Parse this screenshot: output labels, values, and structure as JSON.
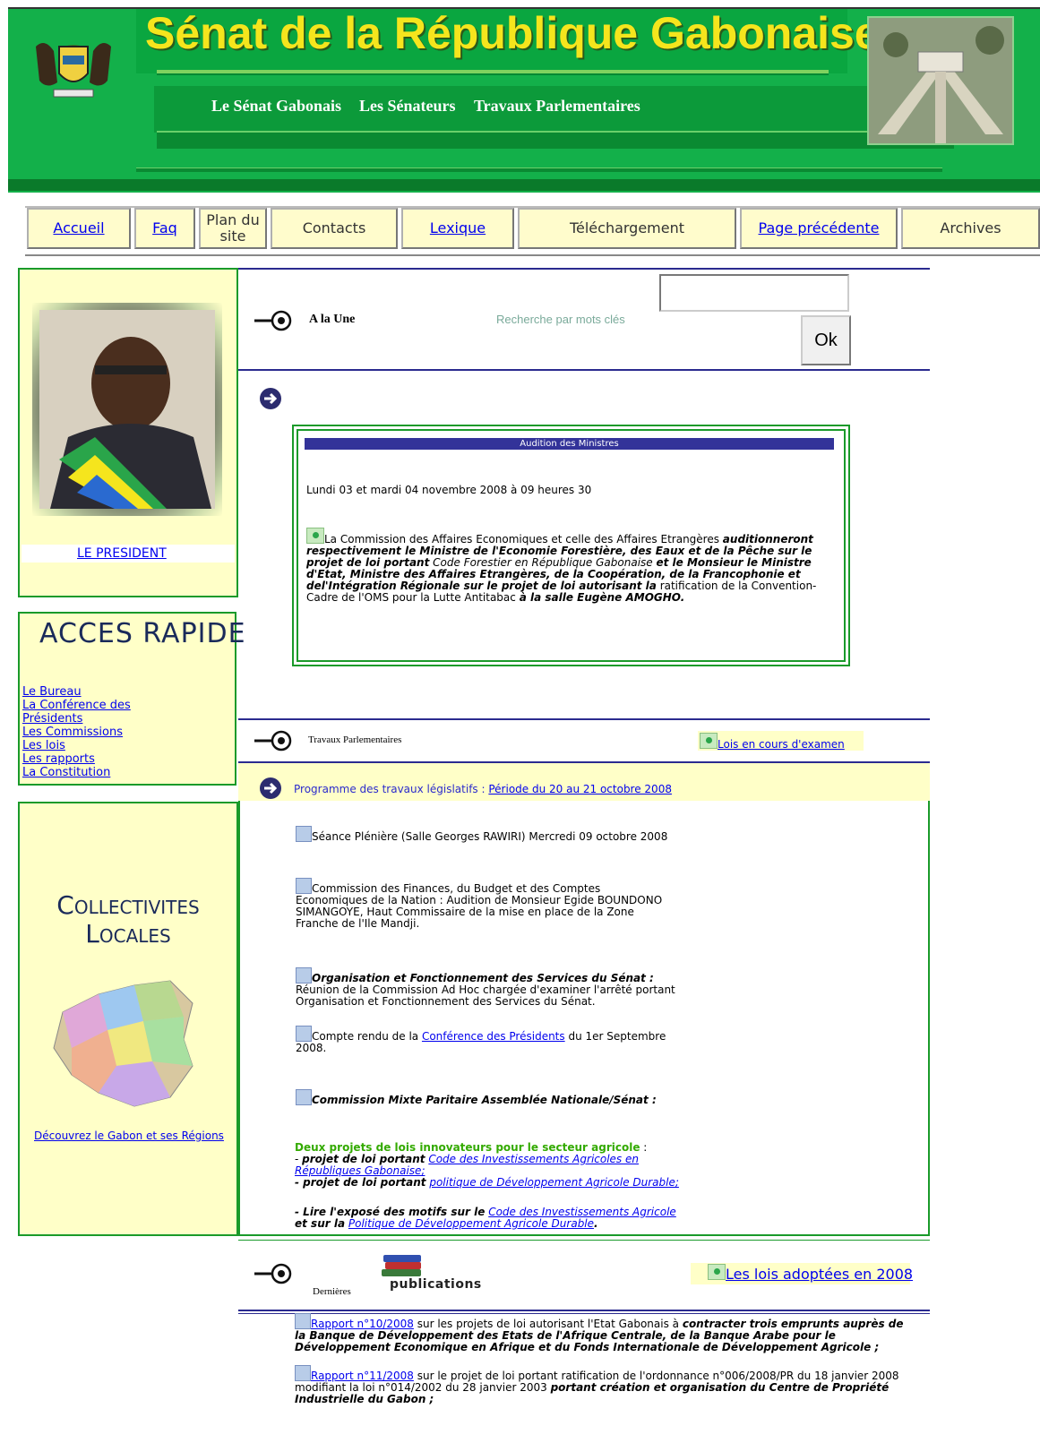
{
  "header": {
    "site_title": "Sénat de la République Gabonaise",
    "nav": [
      "Le Sénat Gabonais",
      "Les Sénateurs",
      "Travaux Parlementaires"
    ]
  },
  "menu": [
    {
      "label": "Accueil",
      "link": true
    },
    {
      "label": "Faq",
      "link": true
    },
    {
      "label": "Plan du site",
      "link": false
    },
    {
      "label": "Contacts",
      "link": false
    },
    {
      "label": "Lexique",
      "link": true
    },
    {
      "label": "Téléchargement",
      "link": false
    },
    {
      "label": "Page précédente",
      "link": true
    },
    {
      "label": "Archives",
      "link": false
    }
  ],
  "president": {
    "label": "LE PRESIDENT"
  },
  "acces_rapide": {
    "title": "ACCES RAPIDE",
    "links": [
      "Le Bureau",
      "La Conférence des Présidents",
      "Les Commissions",
      "Les lois",
      "Les rapports",
      "La Constitution"
    ]
  },
  "collectivites": {
    "title_line1": "Collectivites",
    "title_line2": "Locales",
    "link": "Découvrez le Gabon et ses Régions"
  },
  "une": {
    "label": "A la Une",
    "search_label": "Recherche par mots clés",
    "search_value": "",
    "ok": "Ok"
  },
  "audition": {
    "title": "Audition des Ministres",
    "date": "Lundi 03 et mardi 04 novembre 2008 à 09 heures 30",
    "t1": "La Commission des Affaires Economiques et celle des Affaires Etrangères ",
    "t2": "auditionneront respectivement le Ministre de l'Economie Forestière, des Eaux et de la Pêche sur le projet de loi portant",
    "t3": " Code Forestier en République Gabonaise ",
    "t4": "et le Monsieur le Ministre d'Etat, Ministre des Affaires Etrangères, de la Coopération, de la Francophonie et del'Intégration Régionale sur le projet de loi autorisant la",
    "t5": " ratification de la Convention-Cadre de l'OMS pour la Lutte Antitabac ",
    "t6": "à la salle Eugène AMOGHO."
  },
  "travaux": {
    "label": "Travaux Parlementaires",
    "lois_link": "Lois en cours d'examen",
    "programme_prefix": "Programme des travaux législatifs : ",
    "programme_link": "Période du 20 au 21 octobre 2008",
    "item1": "Séance Plénière (Salle Georges RAWIRI) Mercredi 09 octobre 2008",
    "item2": "Commission des Finances, du Budget et des Comptes Economiques de la Nation : Audition de Monsieur Egide BOUNDONO SIMANGOYE, Haut Commissaire de la mise en place de la Zone Franche de l'Ile Mandji.",
    "item3_bold": "Organisation et Fonctionnement des Services du Sénat :",
    "item3_text": "Réunion de la Commission Ad Hoc chargée d'examiner l'arrêté portant Organisation et Fonctionnement des Services du Sénat.",
    "item4_pre": "Compte rendu de la ",
    "item4_link": "Conférence des Présidents",
    "item4_post": " du 1er Septembre 2008.",
    "item5": "Commission Mixte Paritaire Assemblée Nationale/Sénat :",
    "agri_title": "Deux projets de lois innovateurs pour le secteur agricole",
    "agri_colon": " :",
    "agri1_bold": "projet de loi portant",
    "agri1_link": "Code des Investissements Agricoles en Républiques Gabonaise;",
    "agri2_bold": "projet de loi portant",
    "agri2_link": "politique de Développement Agricole Durable;",
    "expose_bold": "Lire l'exposé des motifs sur le",
    "expose_link1": "Code des Investissements Agricole",
    "expose_mid": "et sur la",
    "expose_link2": "Politique de Développement Agricole Durable"
  },
  "publications": {
    "dernieres": "Dernières",
    "pub_word": "publications",
    "lois_adoptees": "Les lois adoptées en 2008",
    "r1_link": "Rapport n°10/2008",
    "r1_text": " sur les projets de loi autorisant l'Etat Gabonais à ",
    "r1_bold": "contracter trois emprunts auprès de la Banque de Développement des Etats de l'Afrique Centrale, de la Banque Arabe pour le Développement Economique en Afrique et du Fonds Internationale de Développement Agricole ;",
    "r2_link": "Rapport n°11/2008",
    "r2_text": " sur le projet de loi portant ratification de l'ordonnance n°006/2008/PR du 18 janvier 2008 modifiant la loi n°014/2002 du 28 janvier 2003 ",
    "r2_bold": "portant création et organisation du Centre de Propriété Industrielle du Gabon ;"
  },
  "colors": {
    "banner": "#13b04a",
    "title_yellow": "#f5e51d",
    "left_bg": "#ffffc8",
    "border_green": "#1a9a2a",
    "rule_blue": "#2b2b8f"
  }
}
